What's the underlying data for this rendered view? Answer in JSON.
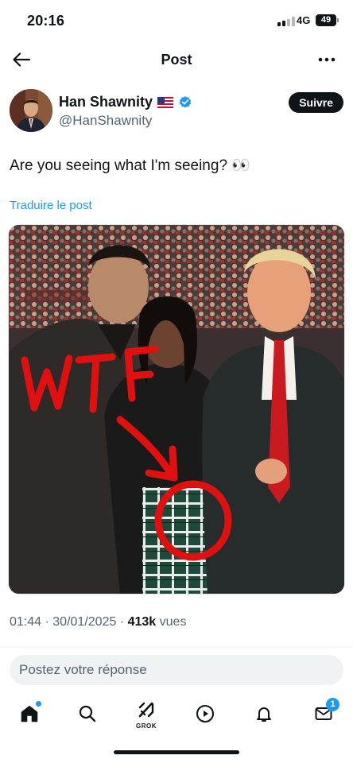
{
  "status_bar": {
    "time": "20:16",
    "network": "4G",
    "battery": "49",
    "signal_bars_active": 2
  },
  "header": {
    "title": "Post",
    "back_icon": "arrow-left-icon",
    "more_icon": "more-horizontal-icon"
  },
  "author": {
    "display_name": "Han Shawnity",
    "handle": "@HanShawnity",
    "follow_label": "Suivre",
    "flag_icon": "us-flag-icon",
    "verified_icon": "verified-badge-icon",
    "verified_color": "#1d9bf0"
  },
  "post": {
    "text": "Are you seeing what I'm seeing? 👀",
    "translate_label": "Traduire le post",
    "image_annotation": "WTF",
    "annotation_color": "#e01010"
  },
  "meta": {
    "time": "01:44",
    "date": "30/01/2025",
    "views_count": "413k",
    "views_label": "vues",
    "separator": "·"
  },
  "reply": {
    "placeholder": "Postez votre réponse"
  },
  "bottom_nav": {
    "items": [
      {
        "name": "home",
        "icon": "home-icon"
      },
      {
        "name": "search",
        "icon": "search-icon"
      },
      {
        "name": "grok",
        "icon": "grok-icon",
        "label": "GROK"
      },
      {
        "name": "video",
        "icon": "play-circle-icon"
      },
      {
        "name": "notifications",
        "icon": "bell-icon"
      },
      {
        "name": "messages",
        "icon": "envelope-icon",
        "badge": "1"
      }
    ]
  },
  "colors": {
    "accent": "#1d9bf0",
    "text_primary": "#0f1419",
    "text_secondary": "#536471"
  }
}
